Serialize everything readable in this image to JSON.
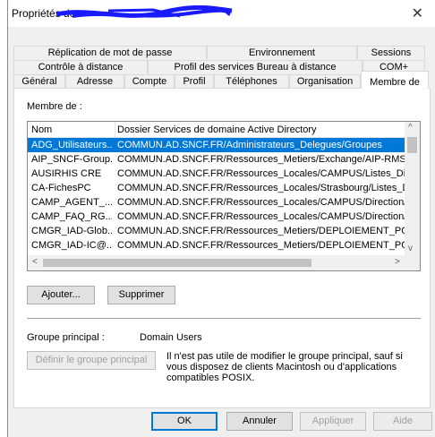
{
  "window": {
    "title": "Propriétés de",
    "close_glyph": "✕"
  },
  "tabs": {
    "row1": [
      "Réplication de mot de passe",
      "Environnement",
      "Sessions"
    ],
    "row2": [
      "Contrôle à distance",
      "Profil des services Bureau à distance",
      "COM+"
    ],
    "row3": [
      "Général",
      "Adresse",
      "Compte",
      "Profil",
      "Téléphones",
      "Organisation",
      "Membre de"
    ],
    "active": "Membre de"
  },
  "member_of": {
    "label": "Membre de :",
    "columns": [
      "Nom",
      "Dossier Services de domaine Active Directory"
    ],
    "rows": [
      {
        "name": "ADG_Utilisateurs...",
        "folder": "COMMUN.AD.SNCF.FR/Administrateurs_Delegues/Groupes",
        "selected": true
      },
      {
        "name": "AIP_SNCF-Group...",
        "folder": "COMMUN.AD.SNCF.FR/Ressources_Metiers/Exchange/AIP-RMS."
      },
      {
        "name": "AUSIRHIS CRE",
        "folder": "COMMUN.AD.SNCF.FR/Ressources_Locales/CAMPUS/Listes_Dis"
      },
      {
        "name": "CA-FichesPC",
        "folder": "COMMUN.AD.SNCF.FR/Ressources_Locales/Strasbourg/Listes_D"
      },
      {
        "name": "CAMP_AGENT_...",
        "folder": "COMMUN.AD.SNCF.FR/Ressources_Locales/CAMPUS/Direction/"
      },
      {
        "name": "CAMP_FAQ_RG...",
        "folder": "COMMUN.AD.SNCF.FR/Ressources_Locales/CAMPUS/Direction/"
      },
      {
        "name": "CMGR_IAD-Glob...",
        "folder": "COMMUN.AD.SNCF.FR/Ressources_Metiers/DEPLOIEMENT_PO"
      },
      {
        "name": "CMGR_IAD-IC@...",
        "folder": "COMMUN.AD.SNCF.FR/Ressources_Metiers/DEPLOIEMENT_PO"
      }
    ],
    "add_button": "Ajouter...",
    "remove_button": "Supprimer"
  },
  "primary_group": {
    "label": "Groupe principal :",
    "value": "Domain Users",
    "set_button": "Définir le groupe principal",
    "info": "Il n'est pas utile de modifier le groupe principal, sauf si vous disposez de clients Macintosh ou d'applications compatibles POSIX."
  },
  "footer": {
    "ok": "OK",
    "cancel": "Annuler",
    "apply": "Appliquer",
    "help": "Aide"
  },
  "colors": {
    "selection": "#0078d7",
    "redaction": "#1a1aff"
  }
}
